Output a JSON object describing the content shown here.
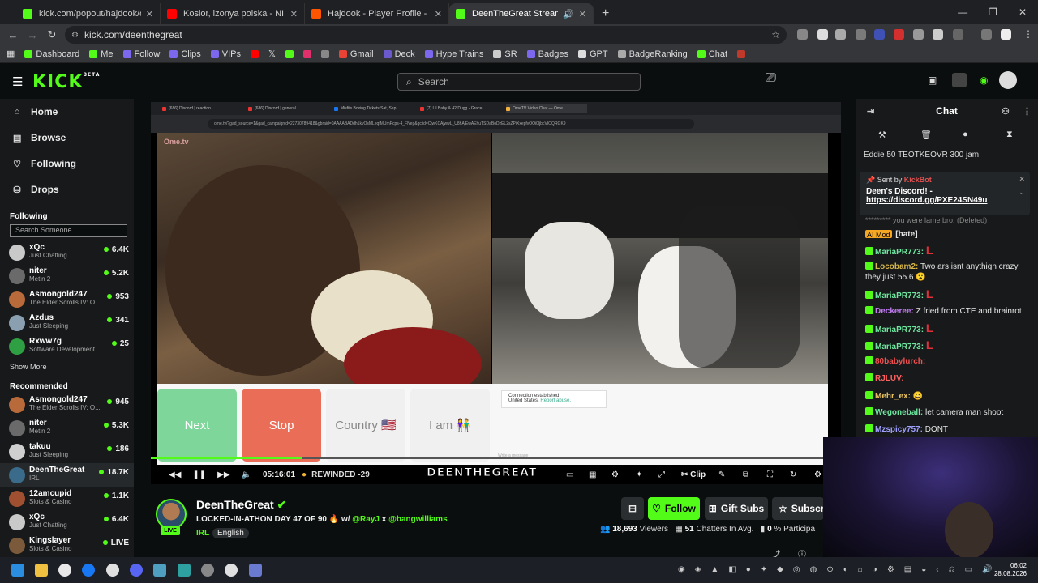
{
  "browser": {
    "tabs": [
      {
        "title": "kick.com/popout/hajdook/chat",
        "color": "#53fc18"
      },
      {
        "title": "Kosior, izonya polska - NIE MA",
        "color": "#ff0000"
      },
      {
        "title": "Hajdook - Player Profile - FACE",
        "color": "#ff5500"
      },
      {
        "title": "DeenTheGreat Stream - Wa",
        "color": "#53fc18"
      }
    ],
    "url": "kick.com/deenthegreat",
    "bookmarks": [
      "Dashboard",
      "Me",
      "Follow",
      "Clips",
      "VIPs",
      "Gmail",
      "Deck",
      "Hype Trains",
      "SR",
      "Badges",
      "GPT",
      "BadgeRanking",
      "Chat"
    ]
  },
  "kick": {
    "search_placeholder": "Search",
    "nav": [
      {
        "label": "Home",
        "icon": "home-icon",
        "glyph": "⌂"
      },
      {
        "label": "Browse",
        "icon": "browse-icon",
        "glyph": "▤"
      },
      {
        "label": "Following",
        "icon": "heart-icon",
        "glyph": "♡"
      },
      {
        "label": "Drops",
        "icon": "drops-icon",
        "glyph": "⛁"
      }
    ],
    "following_title": "Following",
    "following_search": "Search Someone...",
    "following": [
      {
        "name": "xQc",
        "game": "Just Chatting",
        "viewers": "6.4K",
        "color": "#c9c9c9"
      },
      {
        "name": "niter",
        "game": "Metin 2",
        "viewers": "5.2K",
        "color": "#6a6a6a"
      },
      {
        "name": "Asmongold247",
        "game": "The Elder Scrolls IV: O...",
        "viewers": "953",
        "color": "#b86a3a"
      },
      {
        "name": "Azdus",
        "game": "Just Sleeping",
        "viewers": "341",
        "color": "#8aa0b0"
      },
      {
        "name": "Rxww7g",
        "game": "Software Development",
        "viewers": "25",
        "color": "#2ea043"
      }
    ],
    "show_more": "Show More",
    "recommended_title": "Recommended",
    "recommended": [
      {
        "name": "Asmongold247",
        "game": "The Elder Scrolls IV: O...",
        "viewers": "945",
        "color": "#b86a3a"
      },
      {
        "name": "niter",
        "game": "Metin 2",
        "viewers": "5.3K",
        "color": "#6a6a6a"
      },
      {
        "name": "takuu",
        "game": "Just Sleeping",
        "viewers": "186",
        "color": "#cfcfcf"
      },
      {
        "name": "DeenTheGreat",
        "game": "IRL",
        "viewers": "18.7K",
        "color": "#3a6b8a"
      },
      {
        "name": "12amcupid",
        "game": "Slots & Casino",
        "viewers": "1.1K",
        "color": "#a05030"
      },
      {
        "name": "xQc",
        "game": "Just Chatting",
        "viewers": "6.4K",
        "color": "#c9c9c9"
      },
      {
        "name": "Kingslayer",
        "game": "Slots & Casino",
        "viewers": "LIVE",
        "color": "#7a5a3a"
      }
    ]
  },
  "player": {
    "inner_tabs": [
      "(686) Discord | reaction",
      "(686) Discord | general",
      "Misfits Boxing Tickets Sat, Sep",
      "(7) Lil Baby & 42 Dugg - Grace",
      "OmeTV Video Chat — Ome"
    ],
    "inner_url": "ome.tv/?gad_source=1&gad_campaignid=22730789418&gbraid=0AAAABADdh1kvOsMLeqfMUmPcps-4_FNep&gclid=CjwKCAjwwL_U8hAjEwAEhuTSDaBoDzEL2sZPiXxepfvOOi0ljbcVIOQRGK9",
    "ome_logo": "Ome.tv",
    "buttons": {
      "next": "Next",
      "stop": "Stop",
      "country": "Country 🇺🇸",
      "iam": "I am 👫"
    },
    "connection": "Connection established",
    "connection_loc": "United States.",
    "report": "Report abuse.",
    "message_placeholder": "Write a message",
    "time": "05:16:01",
    "rewind": "REWINDED -29",
    "overlay_name": "DEENTHEGREAT",
    "clip_label": "Clip",
    "progress": 0.22
  },
  "stream": {
    "streamer": "DeenTheGreat",
    "live": "LIVE",
    "title_prefix": "LOCKED-IN-ATHON DAY 47 OF 90 🔥 w/ ",
    "mention1": "@RayJ",
    "sep": " x ",
    "mention2": "@bangwilliams",
    "category": "IRL",
    "language": "English",
    "follow": "Follow",
    "gift": "Gift Subs",
    "subscribe": "Subscri",
    "viewers": "18,693",
    "viewers_label": "Viewers",
    "chatters": "51",
    "chatters_label": "Chatters In Avg.",
    "participation": "0",
    "participation_label": "% Participa"
  },
  "chat": {
    "title": "Chat",
    "gifters": "Eddie 50   TEOTKEOVR 300   jam",
    "pinned_by": "Sent by",
    "pinned_user": "KickBot",
    "pinned_text": "Deen's Discord! -",
    "pinned_link": "https://discord.gg/PXE24SN49u",
    "deleted": "********* you were lame bro. (Deleted)",
    "messages": [
      {
        "user": "AI Mod",
        "text": "[hate]",
        "color": "#f5a623"
      },
      {
        "user": "MariaPR773:",
        "text": "L",
        "color": "#6ee7a0",
        "big": true
      },
      {
        "user": "Locobam2:",
        "text": "Two ars isnt anythign crazy they just 55.6 😮",
        "color": "#d9b84a"
      },
      {
        "user": "MariaPR773:",
        "text": "L",
        "color": "#6ee7a0",
        "big": true
      },
      {
        "user": "Deckeree:",
        "text": "Z fried from CTE and brainrot",
        "color": "#c07cf0"
      },
      {
        "user": "MariaPR773:",
        "text": "L",
        "color": "#6ee7a0",
        "big": true
      },
      {
        "user": "MariaPR773:",
        "text": "L",
        "color": "#6ee7a0",
        "big": true
      },
      {
        "user": "80babylurch:",
        "text": "",
        "color": "#f05050"
      },
      {
        "user": "RJLUV:",
        "text": "",
        "color": "#ff6060"
      },
      {
        "user": "Mehr_ex:",
        "text": "😀",
        "color": "#e8c060"
      },
      {
        "user": "Wegoneball:",
        "text": "let camera man shoot",
        "color": "#6ee7a0"
      },
      {
        "user": "Mzspicy757:",
        "text": "DONT",
        "color": "#a0a0ff"
      }
    ]
  },
  "taskbar": {
    "time": "06:02",
    "date": "28.08.2026"
  }
}
